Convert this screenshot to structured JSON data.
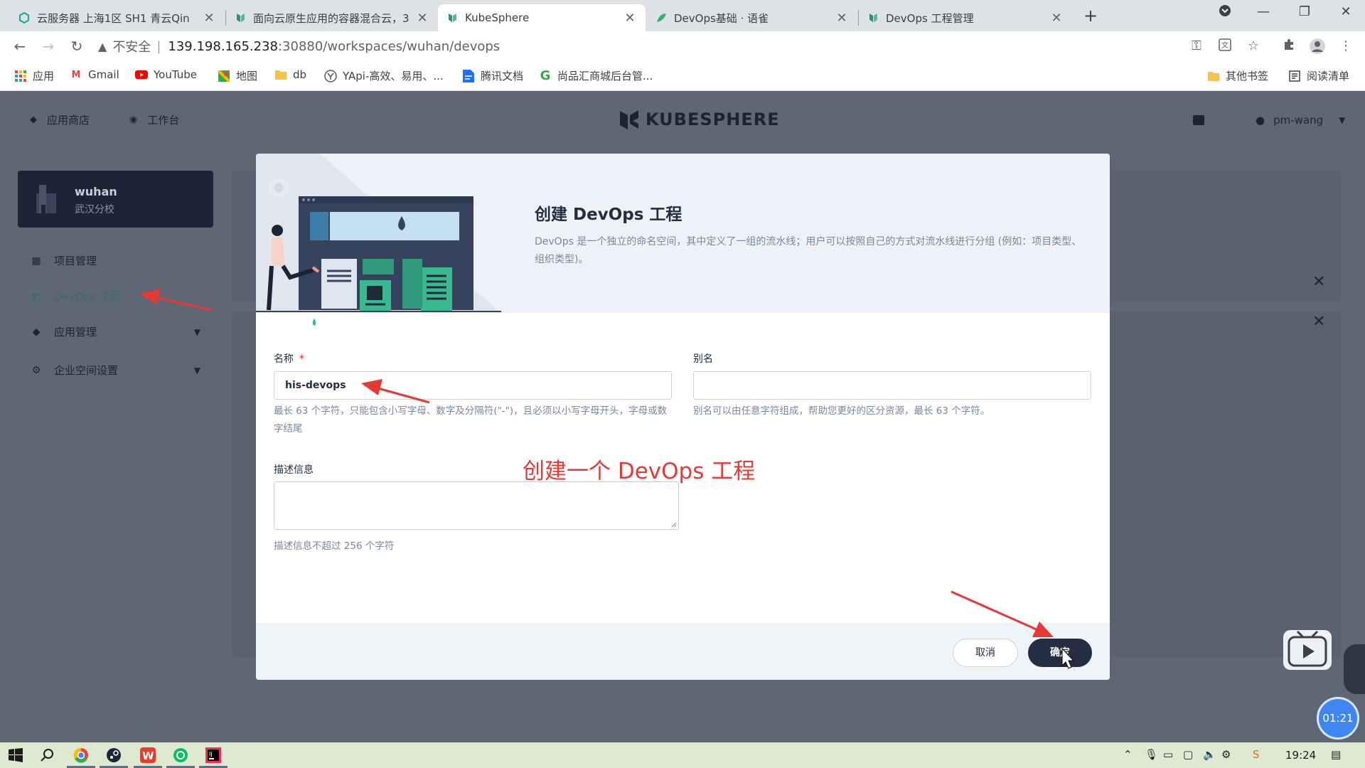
{
  "browser": {
    "tabs": [
      {
        "title": "云服务器 上海1区 SH1 青云Qin",
        "active": false
      },
      {
        "title": "面向云原生应用的容器混合云，3",
        "active": false
      },
      {
        "title": "KubeSphere",
        "active": true
      },
      {
        "title": "DevOps基础 · 语雀",
        "active": false
      },
      {
        "title": "DevOps 工程管理",
        "active": false
      }
    ],
    "address": {
      "security_label": "不安全",
      "host": "139.198.165.238",
      "path": ":30880/workspaces/wuhan/devops"
    },
    "bookmarks": [
      {
        "label": "应用",
        "icon": "apps-grid-icon"
      },
      {
        "label": "Gmail",
        "icon": "gmail-icon"
      },
      {
        "label": "YouTube",
        "icon": "youtube-icon"
      },
      {
        "label": "地图",
        "icon": "maps-icon"
      },
      {
        "label": "db",
        "icon": "folder-icon"
      },
      {
        "label": "YApi-高效、易用、...",
        "icon": "yapi-icon"
      },
      {
        "label": "腾讯文档",
        "icon": "tencent-docs-icon"
      },
      {
        "label": "尚品汇商城后台管...",
        "icon": "g-icon"
      }
    ],
    "bookmarks_right": [
      {
        "label": "其他书签",
        "icon": "folder-icon"
      },
      {
        "label": "阅读清单",
        "icon": "reading-list-icon"
      }
    ]
  },
  "app": {
    "top_links": {
      "app_store": "应用商店",
      "workbench": "工作台"
    },
    "logo": "KUBESPHERE",
    "user": "pm-wang",
    "workspace": {
      "name": "wuhan",
      "desc": "武汉分校"
    },
    "nav": [
      {
        "label": "项目管理",
        "icon": "project-icon",
        "expandable": false
      },
      {
        "label": "DevOps 工程",
        "icon": "devops-icon",
        "expandable": false,
        "active": true
      },
      {
        "label": "应用管理",
        "icon": "app-icon",
        "expandable": true
      },
      {
        "label": "企业空间设置",
        "icon": "gear-icon",
        "expandable": true
      }
    ]
  },
  "modal": {
    "title": "创建 DevOps 工程",
    "description": "DevOps 是一个独立的命名空间，其中定义了一组的流水线；用户可以按照自己的方式对流水线进行分组 (例如：项目类型、组织类型)。",
    "name_label": "名称",
    "name_required_mark": "*",
    "name_value": "his-devops",
    "name_hint": "最长 63 个字符，只能包含小写字母、数字及分隔符(\"-\")，且必须以小写字母开头，字母或数字结尾",
    "alias_label": "别名",
    "alias_value": "",
    "alias_hint": "别名可以由任意字符组成，帮助您更好的区分资源，最长 63 个字符。",
    "desc_label": "描述信息",
    "desc_value": "",
    "desc_hint": "描述信息不超过 256 个字符",
    "cancel_label": "取消",
    "ok_label": "确定"
  },
  "overlay_caption": "创建一个 DevOps 工程",
  "timer": "01:21",
  "taskbar": {
    "time": "19:24"
  },
  "colors": {
    "dark": "#242e42",
    "overlay": "#5f6674",
    "annotation_red": "#e53935",
    "devops_green": "#55bc8a"
  }
}
